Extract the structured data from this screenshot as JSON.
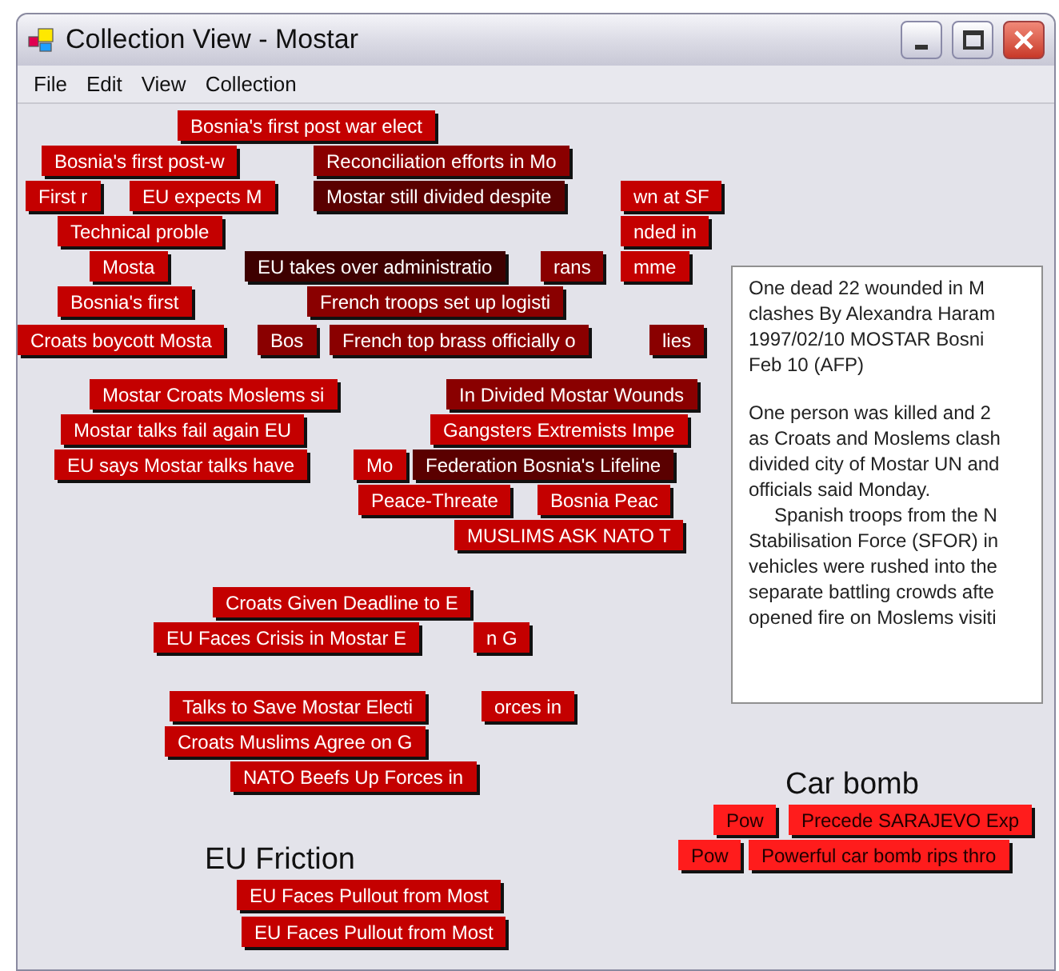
{
  "window": {
    "title": "Collection View - Mostar"
  },
  "menu": [
    "File",
    "Edit",
    "View",
    "Collection"
  ],
  "groups": [
    {
      "label": "EU Friction"
    },
    {
      "label": "Car bomb"
    }
  ],
  "cards": [
    {
      "text": "Bosnia's first post war elect",
      "color": "#c40000"
    },
    {
      "text": "Bosnia's first post-w",
      "color": "#c40000"
    },
    {
      "text": "Reconciliation efforts in Mo",
      "color": "#8a0000"
    },
    {
      "text": "First r",
      "color": "#c40000"
    },
    {
      "text": "EU expects M",
      "color": "#c40000"
    },
    {
      "text": "Mostar still divided despite",
      "color": "#5a0000"
    },
    {
      "text": "wn at SF",
      "color": "#c40000"
    },
    {
      "text": "Technical proble",
      "color": "#c40000"
    },
    {
      "text": "nded in",
      "color": "#c40000"
    },
    {
      "text": "Mosta",
      "color": "#c40000"
    },
    {
      "text": "EU takes over administratio",
      "color": "#3e0000"
    },
    {
      "text": "rans",
      "color": "#8a0000"
    },
    {
      "text": "mme",
      "color": "#c40000"
    },
    {
      "text": "Bosnia's first",
      "color": "#c40000"
    },
    {
      "text": "French troops set up logisti",
      "color": "#8a0000"
    },
    {
      "text": "Croats boycott Mosta",
      "color": "#c40000"
    },
    {
      "text": "Bos",
      "color": "#8a0000"
    },
    {
      "text": "French top brass officially o",
      "color": "#8a0000"
    },
    {
      "text": "lies",
      "color": "#8a0000"
    },
    {
      "text": "Mostar Croats Moslems si",
      "color": "#c40000"
    },
    {
      "text": "In Divided Mostar Wounds",
      "color": "#8a0000"
    },
    {
      "text": "Mostar talks fail again EU",
      "color": "#c40000"
    },
    {
      "text": "Gangsters Extremists Impe",
      "color": "#c40000"
    },
    {
      "text": "EU says Mostar talks have",
      "color": "#c40000"
    },
    {
      "text": "Mo",
      "color": "#c40000"
    },
    {
      "text": "Federation Bosnia's Lifeline",
      "color": "#5a0000"
    },
    {
      "text": "Peace-Threate",
      "color": "#c40000"
    },
    {
      "text": "Bosnia Peac",
      "color": "#c40000"
    },
    {
      "text": "MUSLIMS ASK NATO T",
      "color": "#c40000"
    },
    {
      "text": "Croats Given Deadline to E",
      "color": "#c40000"
    },
    {
      "text": "EU Faces Crisis in Mostar E",
      "color": "#c40000"
    },
    {
      "text": "n G",
      "color": "#c40000"
    },
    {
      "text": "Talks to Save Mostar Electi",
      "color": "#c40000"
    },
    {
      "text": "orces in",
      "color": "#c40000"
    },
    {
      "text": "Croats Muslims Agree on G",
      "color": "#c40000"
    },
    {
      "text": "NATO Beefs Up Forces in",
      "color": "#c40000"
    },
    {
      "text": "Pow",
      "color": "#ff1c1c"
    },
    {
      "text": "Precede SARAJEVO Exp",
      "color": "#ff1c1c"
    },
    {
      "text": "Pow",
      "color": "#ff1c1c"
    },
    {
      "text": "Powerful car bomb rips thro",
      "color": "#ff1c1c"
    },
    {
      "text": "EU Faces Pullout from Most",
      "color": "#c40000"
    },
    {
      "text": "EU Faces Pullout from Most",
      "color": "#c40000"
    }
  ],
  "article": {
    "lines": [
      "One dead  22 wounded in M",
      "clashes By Alexandra Haram",
      "1997/02/10   MOSTAR  Bosni",
      "Feb 10 (AFP)"
    ],
    "lines_2": [
      "One person was killed and 2",
      "as Croats and Moslems clash",
      "divided city of Mostar  UN and",
      "officials said Monday."
    ],
    "lines_3": [
      "Spanish troops from the N",
      "Stabilisation Force (SFOR) in",
      "vehicles were rushed into the",
      "separate battling crowds afte",
      "opened fire on Moslems visiti"
    ]
  }
}
